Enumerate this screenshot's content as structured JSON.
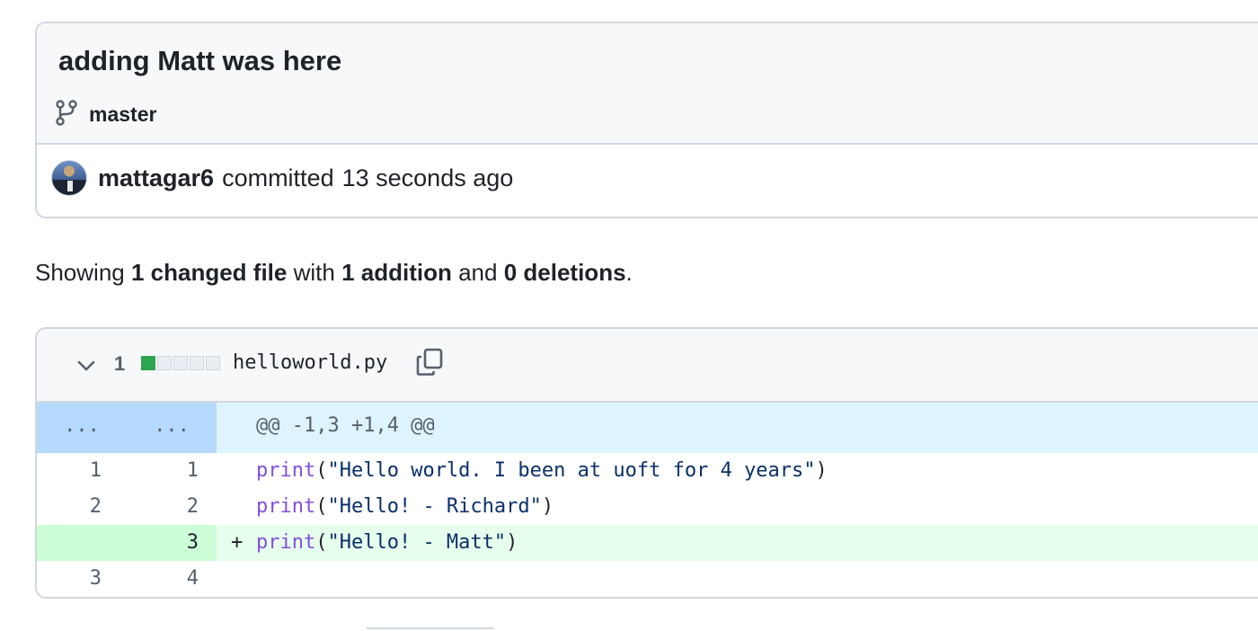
{
  "commit": {
    "title": "adding Matt was here",
    "branch": "master",
    "author": "mattagar6",
    "action": "committed",
    "time": "13 seconds ago"
  },
  "summary": {
    "prefix": "Showing",
    "files_changed": "1 changed file",
    "with": "with",
    "additions": "1 addition",
    "and": "and",
    "deletions": "0 deletions",
    "suffix": "."
  },
  "file": {
    "changes": "1",
    "diffstat": {
      "added_blocks": 1,
      "total_blocks": 5
    },
    "name": "helloworld.py",
    "hunk": {
      "old": "...",
      "new": "...",
      "header": "@@ -1,3 +1,4 @@"
    },
    "lines": [
      {
        "old": "1",
        "new": "1",
        "marker": "",
        "func": "print",
        "open": "(",
        "string": "\"Hello world. I been at uoft for 4 years\"",
        "close": ")"
      },
      {
        "old": "2",
        "new": "2",
        "marker": "",
        "func": "print",
        "open": "(",
        "string": "\"Hello! - Richard\"",
        "close": ")"
      },
      {
        "old": "",
        "new": "3",
        "marker": "+",
        "func": "print",
        "open": "(",
        "string": "\"Hello! - Matt\"",
        "close": ")"
      },
      {
        "old": "3",
        "new": "4",
        "marker": "",
        "func": "",
        "open": "",
        "string": "",
        "close": ""
      }
    ]
  },
  "colors": {
    "added_line_bg": "#e6ffec",
    "added_num_bg": "#ccffd8",
    "hunk_bg": "#ddf4ff",
    "hunk_num_bg": "#b6dafd",
    "diffstat_add": "#2da44e"
  }
}
